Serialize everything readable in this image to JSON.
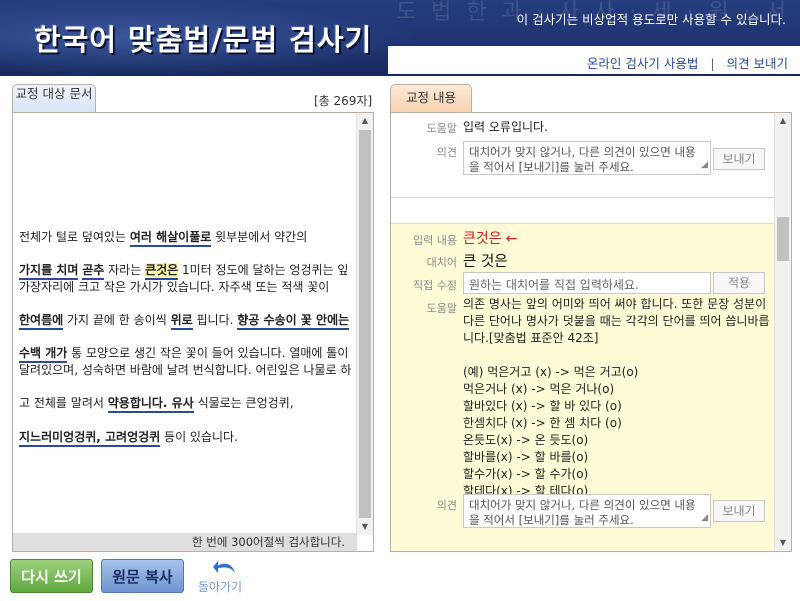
{
  "header": {
    "title": "한국어 맞춤법/문법 검사기",
    "notice": "이 검사기는 비상업적 용도로만 사용할 수 있습니다.",
    "bg_text": "도 법 한 과 · 사 사 · 세 · 원 · 서",
    "links": [
      "온라인 검사기 사용법",
      "의견 보내기"
    ],
    "link_separator": "|"
  },
  "left": {
    "tab_label": "교정 대상 문서",
    "char_count": "[총 269자]",
    "footer": "한 번에 300어절씩 검사합니다.",
    "lines": [
      [
        {
          "t": "전체가 털로 덮여있는 "
        },
        {
          "t": "여러 해살이풀로",
          "h": true
        },
        {
          "t": " 윗부분에서 약간의"
        }
      ],
      [
        {
          "t": "가지를 치며",
          "h": true
        },
        {
          "t": " "
        },
        {
          "t": "곧추",
          "h": true
        },
        {
          "t": " 자라는 "
        },
        {
          "t": "큰것은",
          "h": true,
          "s": true
        },
        {
          "t": " 1미터 정도에 달하는 엉겅퀴는 잎"
        }
      ],
      [
        {
          "t": "가장자리에 크고 작은 가시가 있습니다. 자주색 또는 적색 꽃이"
        }
      ],
      [
        {
          "t": "한여름에",
          "h": true
        },
        {
          "t": " 가지 끝에 한 송이씩 "
        },
        {
          "t": "위로",
          "h": true
        },
        {
          "t": " 핍니다. "
        },
        {
          "t": "향공 수송이 꽃 안에는",
          "h": true
        }
      ],
      [
        {
          "t": "수백 개가",
          "h": true
        },
        {
          "t": " 통 모양으로 생긴 작은 꽃이 들어 있습니다. 열매에 톨이"
        }
      ],
      [
        {
          "t": "달려있으며, 성숙하면 바람에 날려 번식합니다. 어린잎은 나물로 하"
        }
      ],
      [
        {
          "t": "고 전체를 말려서 "
        },
        {
          "t": "약용합니다. 유사",
          "h": true
        },
        {
          "t": " 식물로는 큰엉겅퀴,"
        }
      ],
      [
        {
          "t": "지느러미엉겅퀴, 고려엉겅퀴",
          "h": true
        },
        {
          "t": " 등이 있습니다."
        }
      ]
    ]
  },
  "right": {
    "tab_label": "교정 내용",
    "labels": {
      "help": "도움말",
      "opinion": "의견",
      "input": "입력 내용",
      "replace": "대치어",
      "direct": "직접 수정"
    },
    "first_help": "입력 오류입니다.",
    "opinion_placeholder": "대치어가 맞지 않거나, 다른 의견이 있으면 내용을 적어서 [보내기]를 눌러 주세요.",
    "send_label": "보내기",
    "input_word": "큰것은",
    "input_arrow": "←",
    "replacement": "큰 것은",
    "direct_placeholder": "원하는 대치어를 직접 입력하세요.",
    "apply_label": "적용",
    "help_text": "의존 명사는 앞의 어미와 띄어 써야 합니다. 또한 문장 성분이 다른 단어나 명사가 덧붙을 때는 각각의 단어를 띄어 씁니바릅니다.[맞춤법 표준안 42조]",
    "examples_title": "(예) 먹은거고 (x) -> 먹은 거고(o)",
    "examples": [
      "먹은거나 (x) -> 먹은 거나(o)",
      "할바있다 (x) -> 할 바 있다 (o)",
      "한셈치다 (x) -> 한 셈 치다 (o)",
      "온듯도(x) -> 온 듯도(o)",
      "할바를(x) -> 할 바를(o)",
      "할수가(x) -> 할 수가(o)",
      "할테다(x) -> 할 테다(o)"
    ]
  },
  "bottom": {
    "rewrite_label": "다시 쓰기",
    "copy_label": "원문 복사",
    "back_label": "돌아가기"
  },
  "colors": {
    "header_bg": "#1f3370",
    "highlight_underline": "#2c4a9c",
    "highlight_bg": "#fff7a8",
    "card_bg": "#fffbd6",
    "error_red": "#d12020",
    "rewrite_green": "#5fa83f",
    "copy_blue": "#6e93cf"
  }
}
